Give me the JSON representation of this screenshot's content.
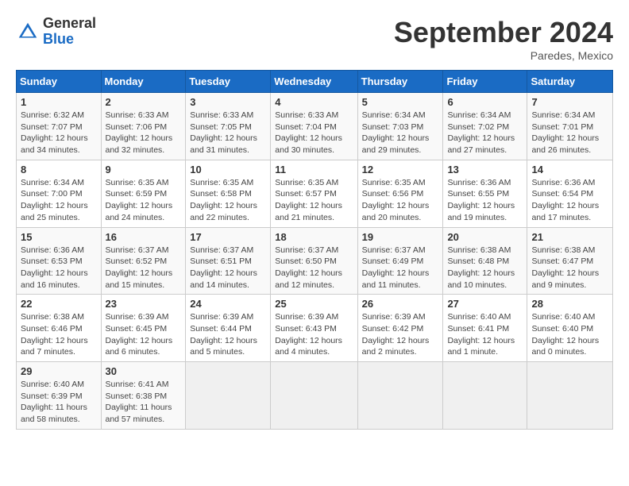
{
  "header": {
    "logo_general": "General",
    "logo_blue": "Blue",
    "month_title": "September 2024",
    "location": "Paredes, Mexico"
  },
  "weekdays": [
    "Sunday",
    "Monday",
    "Tuesday",
    "Wednesday",
    "Thursday",
    "Friday",
    "Saturday"
  ],
  "weeks": [
    [
      {
        "day": "1",
        "info": "Sunrise: 6:32 AM\nSunset: 7:07 PM\nDaylight: 12 hours\nand 34 minutes."
      },
      {
        "day": "2",
        "info": "Sunrise: 6:33 AM\nSunset: 7:06 PM\nDaylight: 12 hours\nand 32 minutes."
      },
      {
        "day": "3",
        "info": "Sunrise: 6:33 AM\nSunset: 7:05 PM\nDaylight: 12 hours\nand 31 minutes."
      },
      {
        "day": "4",
        "info": "Sunrise: 6:33 AM\nSunset: 7:04 PM\nDaylight: 12 hours\nand 30 minutes."
      },
      {
        "day": "5",
        "info": "Sunrise: 6:34 AM\nSunset: 7:03 PM\nDaylight: 12 hours\nand 29 minutes."
      },
      {
        "day": "6",
        "info": "Sunrise: 6:34 AM\nSunset: 7:02 PM\nDaylight: 12 hours\nand 27 minutes."
      },
      {
        "day": "7",
        "info": "Sunrise: 6:34 AM\nSunset: 7:01 PM\nDaylight: 12 hours\nand 26 minutes."
      }
    ],
    [
      {
        "day": "8",
        "info": "Sunrise: 6:34 AM\nSunset: 7:00 PM\nDaylight: 12 hours\nand 25 minutes."
      },
      {
        "day": "9",
        "info": "Sunrise: 6:35 AM\nSunset: 6:59 PM\nDaylight: 12 hours\nand 24 minutes."
      },
      {
        "day": "10",
        "info": "Sunrise: 6:35 AM\nSunset: 6:58 PM\nDaylight: 12 hours\nand 22 minutes."
      },
      {
        "day": "11",
        "info": "Sunrise: 6:35 AM\nSunset: 6:57 PM\nDaylight: 12 hours\nand 21 minutes."
      },
      {
        "day": "12",
        "info": "Sunrise: 6:35 AM\nSunset: 6:56 PM\nDaylight: 12 hours\nand 20 minutes."
      },
      {
        "day": "13",
        "info": "Sunrise: 6:36 AM\nSunset: 6:55 PM\nDaylight: 12 hours\nand 19 minutes."
      },
      {
        "day": "14",
        "info": "Sunrise: 6:36 AM\nSunset: 6:54 PM\nDaylight: 12 hours\nand 17 minutes."
      }
    ],
    [
      {
        "day": "15",
        "info": "Sunrise: 6:36 AM\nSunset: 6:53 PM\nDaylight: 12 hours\nand 16 minutes."
      },
      {
        "day": "16",
        "info": "Sunrise: 6:37 AM\nSunset: 6:52 PM\nDaylight: 12 hours\nand 15 minutes."
      },
      {
        "day": "17",
        "info": "Sunrise: 6:37 AM\nSunset: 6:51 PM\nDaylight: 12 hours\nand 14 minutes."
      },
      {
        "day": "18",
        "info": "Sunrise: 6:37 AM\nSunset: 6:50 PM\nDaylight: 12 hours\nand 12 minutes."
      },
      {
        "day": "19",
        "info": "Sunrise: 6:37 AM\nSunset: 6:49 PM\nDaylight: 12 hours\nand 11 minutes."
      },
      {
        "day": "20",
        "info": "Sunrise: 6:38 AM\nSunset: 6:48 PM\nDaylight: 12 hours\nand 10 minutes."
      },
      {
        "day": "21",
        "info": "Sunrise: 6:38 AM\nSunset: 6:47 PM\nDaylight: 12 hours\nand 9 minutes."
      }
    ],
    [
      {
        "day": "22",
        "info": "Sunrise: 6:38 AM\nSunset: 6:46 PM\nDaylight: 12 hours\nand 7 minutes."
      },
      {
        "day": "23",
        "info": "Sunrise: 6:39 AM\nSunset: 6:45 PM\nDaylight: 12 hours\nand 6 minutes."
      },
      {
        "day": "24",
        "info": "Sunrise: 6:39 AM\nSunset: 6:44 PM\nDaylight: 12 hours\nand 5 minutes."
      },
      {
        "day": "25",
        "info": "Sunrise: 6:39 AM\nSunset: 6:43 PM\nDaylight: 12 hours\nand 4 minutes."
      },
      {
        "day": "26",
        "info": "Sunrise: 6:39 AM\nSunset: 6:42 PM\nDaylight: 12 hours\nand 2 minutes."
      },
      {
        "day": "27",
        "info": "Sunrise: 6:40 AM\nSunset: 6:41 PM\nDaylight: 12 hours\nand 1 minute."
      },
      {
        "day": "28",
        "info": "Sunrise: 6:40 AM\nSunset: 6:40 PM\nDaylight: 12 hours\nand 0 minutes."
      }
    ],
    [
      {
        "day": "29",
        "info": "Sunrise: 6:40 AM\nSunset: 6:39 PM\nDaylight: 11 hours\nand 58 minutes."
      },
      {
        "day": "30",
        "info": "Sunrise: 6:41 AM\nSunset: 6:38 PM\nDaylight: 11 hours\nand 57 minutes."
      },
      {
        "day": "",
        "info": ""
      },
      {
        "day": "",
        "info": ""
      },
      {
        "day": "",
        "info": ""
      },
      {
        "day": "",
        "info": ""
      },
      {
        "day": "",
        "info": ""
      }
    ]
  ]
}
